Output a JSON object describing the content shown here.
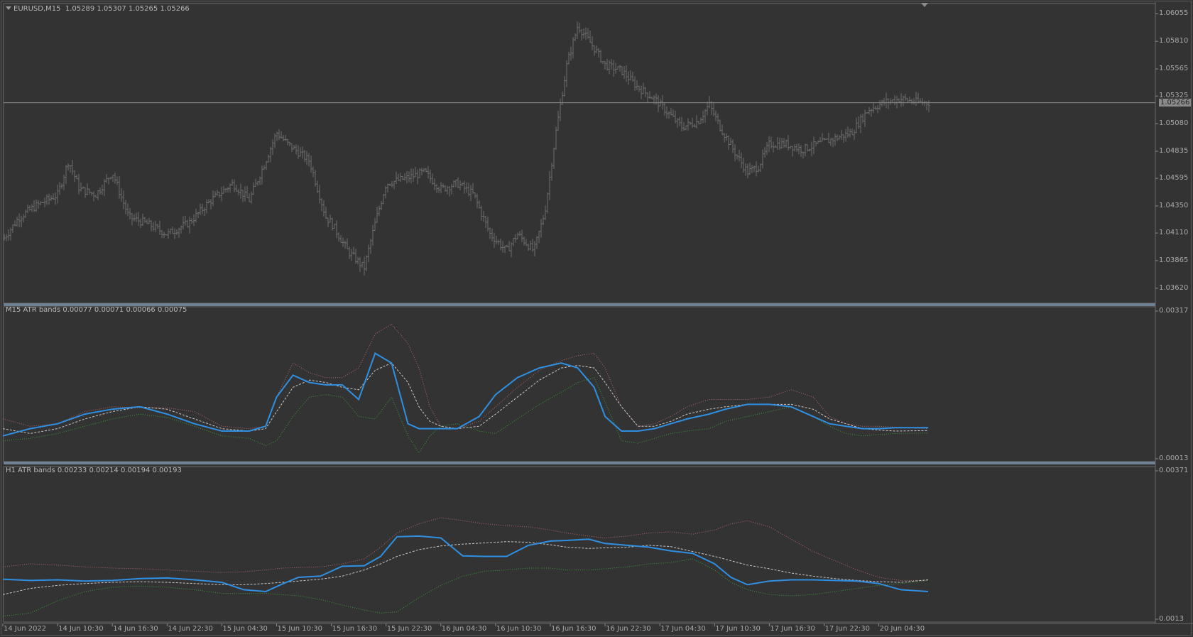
{
  "panes": {
    "main": {
      "title": "EURUSD,M15",
      "ohlc": "1.05289 1.05307 1.05265 1.05266",
      "menu_icon": "triangle-down-icon"
    },
    "atr_m15": {
      "title": "M15 ATR bands 0.00077 0.00071 0.00066 0.00075"
    },
    "atr_h1": {
      "title": "H1 ATR bands 0.00233 0.00214 0.00194 0.00193"
    }
  },
  "current_price": "1.05266",
  "colors": {
    "background": "#333333",
    "bars": "#6e6e6e",
    "atr_line": "#2f8fe0",
    "upper_band": "#b4656b",
    "middle_band": "#c8c8c8",
    "lower_band": "#3a9a3a",
    "grid": "#6a6a6a",
    "pane_separator": "#6f8294"
  },
  "chart_data": [
    {
      "type": "line",
      "title": "EURUSD,M15",
      "subtitle": "1.05289 1.05307 1.05265 1.05266",
      "style": "bar (OHLC)",
      "y_ticks": [
        "1.06055",
        "1.05810",
        "1.05565",
        "1.05325",
        "1.05080",
        "1.04835",
        "1.04595",
        "1.04350",
        "1.04110",
        "1.03865",
        "1.03620"
      ],
      "ylim": [
        1.0355,
        1.0612
      ],
      "last_price": "1.05266",
      "x_ticks": [
        "14 Jun 2022",
        "14 Jun 10:30",
        "14 Jun 16:30",
        "14 Jun 22:30",
        "15 Jun 04:30",
        "15 Jun 10:30",
        "15 Jun 16:30",
        "15 Jun 22:30",
        "16 Jun 04:30",
        "16 Jun 10:30",
        "16 Jun 16:30",
        "16 Jun 22:30",
        "17 Jun 04:30",
        "17 Jun 10:30",
        "17 Jun 16:30",
        "17 Jun 22:30",
        "20 Jun 04:30"
      ],
      "x_positions": [
        0,
        1,
        2,
        3,
        4,
        5,
        6,
        7,
        8,
        9,
        10,
        11,
        12,
        13,
        14,
        15,
        16
      ],
      "close_path": {
        "x": [
          0,
          0.3,
          0.6,
          1.0,
          1.2,
          1.4,
          1.7,
          2.0,
          2.3,
          2.6,
          3.0,
          3.4,
          3.8,
          4.2,
          4.5,
          4.8,
          5.0,
          5.2,
          5.6,
          5.9,
          6.0,
          6.3,
          6.6,
          6.8,
          7.0,
          7.4,
          7.7,
          8.0,
          8.3,
          8.6,
          8.9,
          9.2,
          9.4,
          9.7,
          9.9,
          10.1,
          10.3,
          10.5,
          10.8,
          11.0,
          11.3,
          11.6,
          11.9,
          12.1,
          12.4,
          12.7,
          12.9,
          13.1,
          13.4,
          13.6,
          13.8,
          14.0,
          14.3,
          14.6,
          14.9,
          15.2,
          15.5,
          15.8,
          16.1,
          16.4,
          16.7,
          16.95
        ],
        "y": [
          1.0405,
          1.0425,
          1.0435,
          1.0445,
          1.0475,
          1.045,
          1.0445,
          1.0465,
          1.0425,
          1.042,
          1.041,
          1.042,
          1.044,
          1.0455,
          1.044,
          1.0475,
          1.05,
          1.049,
          1.0475,
          1.0425,
          1.042,
          1.0395,
          1.038,
          1.042,
          1.0455,
          1.046,
          1.0465,
          1.045,
          1.0455,
          1.0445,
          1.041,
          1.0395,
          1.041,
          1.0395,
          1.043,
          1.05,
          1.056,
          1.0595,
          1.0575,
          1.056,
          1.0555,
          1.054,
          1.053,
          1.052,
          1.0505,
          1.051,
          1.0525,
          1.0505,
          1.048,
          1.0465,
          1.047,
          1.049,
          1.049,
          1.0485,
          1.049,
          1.0495,
          1.05,
          1.052,
          1.0527,
          1.053,
          1.0527,
          1.05266
        ]
      }
    },
    {
      "type": "line",
      "title": "M15 ATR bands 0.00077 0.00071 0.00066 0.00075",
      "y_ticks": [
        "0.00317",
        "0.00013"
      ],
      "ylim": [
        0.00013,
        0.00317
      ],
      "x": [
        0,
        0.5,
        1.0,
        1.5,
        2.0,
        2.5,
        3.0,
        3.5,
        4.0,
        4.5,
        4.8,
        5.0,
        5.3,
        5.6,
        5.9,
        6.2,
        6.5,
        6.8,
        7.1,
        7.4,
        7.6,
        7.8,
        8.0,
        8.3,
        8.7,
        9.0,
        9.4,
        9.8,
        10.2,
        10.5,
        10.8,
        11.0,
        11.3,
        11.6,
        11.9,
        12.2,
        12.5,
        12.9,
        13.2,
        13.6,
        14.0,
        14.4,
        14.8,
        15.1,
        15.4,
        15.7,
        16.0,
        16.3,
        16.9
      ],
      "series": [
        {
          "name": "0.00077",
          "style": "solid",
          "color": "#2f8fe0",
          "values": [
            0.0006,
            0.00075,
            0.00085,
            0.00105,
            0.00115,
            0.0012,
            0.00105,
            0.00085,
            0.0007,
            0.0007,
            0.0008,
            0.0014,
            0.00185,
            0.0017,
            0.00165,
            0.00165,
            0.00135,
            0.0023,
            0.0021,
            0.00085,
            0.00075,
            0.00075,
            0.00075,
            0.00075,
            0.001,
            0.00145,
            0.0018,
            0.002,
            0.0021,
            0.002,
            0.0016,
            0.001,
            0.0007,
            0.0007,
            0.00075,
            0.00085,
            0.00095,
            0.00105,
            0.00115,
            0.00125,
            0.00125,
            0.0012,
            0.001,
            0.00085,
            0.0008,
            0.00075,
            0.00075,
            0.00077,
            0.00077
          ]
        },
        {
          "name": "0.00071",
          "style": "dotted",
          "color": "#b4656b",
          "values": [
            0.00095,
            0.0008,
            0.00085,
            0.0011,
            0.0012,
            0.00118,
            0.00118,
            0.0011,
            0.0008,
            0.00075,
            0.0008,
            0.0014,
            0.0021,
            0.0019,
            0.0018,
            0.0018,
            0.002,
            0.0027,
            0.0029,
            0.0025,
            0.002,
            0.0012,
            0.0008,
            0.00075,
            0.0009,
            0.0012,
            0.0016,
            0.00195,
            0.00215,
            0.00225,
            0.0023,
            0.002,
            0.0012,
            0.0008,
            0.00085,
            0.001,
            0.0012,
            0.00135,
            0.00135,
            0.00135,
            0.0014,
            0.00155,
            0.0014,
            0.001,
            0.00085,
            0.0008,
            0.0008,
            0.00078,
            0.00075
          ]
        },
        {
          "name": "0.00066",
          "style": "dashed",
          "color": "#c8c8c8",
          "values": [
            0.00075,
            0.00065,
            0.00075,
            0.00095,
            0.0011,
            0.0012,
            0.00115,
            0.00095,
            0.00075,
            0.0007,
            0.00075,
            0.0011,
            0.0016,
            0.00175,
            0.0017,
            0.0016,
            0.00155,
            0.00195,
            0.0021,
            0.0017,
            0.0012,
            0.0009,
            0.0008,
            0.00075,
            0.0008,
            0.00105,
            0.0014,
            0.00175,
            0.002,
            0.00205,
            0.002,
            0.0017,
            0.0012,
            0.0008,
            0.0008,
            0.0009,
            0.00105,
            0.00115,
            0.0012,
            0.00125,
            0.00125,
            0.00125,
            0.00115,
            0.00095,
            0.00085,
            0.00075,
            0.00072,
            0.0007,
            0.00071
          ]
        },
        {
          "name": "0.00075",
          "style": "dotted",
          "color": "#3a9a3a",
          "values": [
            0.0005,
            0.00055,
            0.00065,
            0.0008,
            0.00095,
            0.00105,
            0.00098,
            0.0008,
            0.0006,
            0.00055,
            0.0004,
            0.0005,
            0.001,
            0.0014,
            0.00145,
            0.0014,
            0.001,
            0.00095,
            0.0014,
            0.0006,
            0.00025,
            0.0006,
            0.0008,
            0.00085,
            0.0007,
            0.00065,
            0.00095,
            0.00125,
            0.0015,
            0.0017,
            0.0018,
            0.0013,
            0.0005,
            0.00045,
            0.00055,
            0.00065,
            0.0007,
            0.00075,
            0.0009,
            0.001,
            0.0011,
            0.0012,
            0.001,
            0.0008,
            0.00065,
            0.0006,
            0.00063,
            0.00065,
            0.00066
          ]
        }
      ]
    },
    {
      "type": "line",
      "title": "H1 ATR bands 0.00233 0.00214 0.00194 0.00193",
      "y_ticks": [
        "0.00371",
        "0.0013"
      ],
      "ylim": [
        0.0013,
        0.00371
      ],
      "x": [
        0,
        0.5,
        1.0,
        1.5,
        2.0,
        2.5,
        3.0,
        3.5,
        4.0,
        4.4,
        4.8,
        5.1,
        5.4,
        5.8,
        6.2,
        6.6,
        6.9,
        7.2,
        7.6,
        8.0,
        8.4,
        8.8,
        9.2,
        9.6,
        10.0,
        10.3,
        10.7,
        11.0,
        11.4,
        11.8,
        12.2,
        12.6,
        13.0,
        13.3,
        13.6,
        14.0,
        14.4,
        14.8,
        15.2,
        15.6,
        16.0,
        16.4,
        16.9
      ],
      "series": [
        {
          "name": "0.00233",
          "style": "solid",
          "color": "#2f8fe0",
          "values": [
            0.00195,
            0.00193,
            0.00194,
            0.00192,
            0.00193,
            0.00196,
            0.00197,
            0.00194,
            0.0019,
            0.00178,
            0.00175,
            0.00187,
            0.00198,
            0.002,
            0.00216,
            0.00217,
            0.00232,
            0.00264,
            0.00265,
            0.00262,
            0.00233,
            0.00232,
            0.00232,
            0.0025,
            0.00257,
            0.00258,
            0.0026,
            0.00253,
            0.0025,
            0.00247,
            0.00241,
            0.00237,
            0.0022,
            0.00198,
            0.00186,
            0.00192,
            0.00194,
            0.00194,
            0.00193,
            0.00192,
            0.00188,
            0.00178,
            0.00175
          ]
        },
        {
          "name": "0.00214",
          "style": "dotted",
          "color": "#b4656b",
          "values": [
            0.00215,
            0.0022,
            0.00218,
            0.00215,
            0.00213,
            0.00212,
            0.0021,
            0.00208,
            0.00206,
            0.00207,
            0.0021,
            0.00213,
            0.00214,
            0.00215,
            0.0022,
            0.00228,
            0.00247,
            0.0027,
            0.00285,
            0.00295,
            0.0029,
            0.00285,
            0.00282,
            0.0028,
            0.00275,
            0.0027,
            0.00265,
            0.00262,
            0.00265,
            0.0027,
            0.00272,
            0.00268,
            0.00275,
            0.00285,
            0.0029,
            0.0028,
            0.0026,
            0.0024,
            0.00225,
            0.0021,
            0.00198,
            0.00193,
            0.00193
          ]
        },
        {
          "name": "0.00194",
          "style": "dashed",
          "color": "#c8c8c8",
          "values": [
            0.0017,
            0.0018,
            0.00185,
            0.00188,
            0.0019,
            0.00191,
            0.0019,
            0.00188,
            0.00186,
            0.00186,
            0.00188,
            0.0019,
            0.00192,
            0.00195,
            0.002,
            0.0021,
            0.0022,
            0.00232,
            0.00243,
            0.00249,
            0.00252,
            0.00254,
            0.00256,
            0.00255,
            0.00251,
            0.00247,
            0.00245,
            0.00246,
            0.00247,
            0.0025,
            0.00248,
            0.0024,
            0.00232,
            0.00225,
            0.00218,
            0.00212,
            0.00205,
            0.002,
            0.00196,
            0.00193,
            0.00191,
            0.0019,
            0.00194
          ]
        },
        {
          "name": "0.00193",
          "style": "dotted",
          "color": "#3a9a3a",
          "values": [
            0.00135,
            0.0014,
            0.0016,
            0.00175,
            0.00182,
            0.00184,
            0.00182,
            0.00178,
            0.00172,
            0.00172,
            0.00172,
            0.0017,
            0.00168,
            0.00162,
            0.00153,
            0.00145,
            0.0014,
            0.00142,
            0.00165,
            0.00185,
            0.002,
            0.00208,
            0.0021,
            0.00213,
            0.00213,
            0.0021,
            0.0021,
            0.00212,
            0.00215,
            0.0022,
            0.00222,
            0.00228,
            0.0021,
            0.0019,
            0.00178,
            0.0017,
            0.00168,
            0.0017,
            0.00175,
            0.0018,
            0.00185,
            0.00188,
            0.00193
          ]
        }
      ]
    }
  ]
}
